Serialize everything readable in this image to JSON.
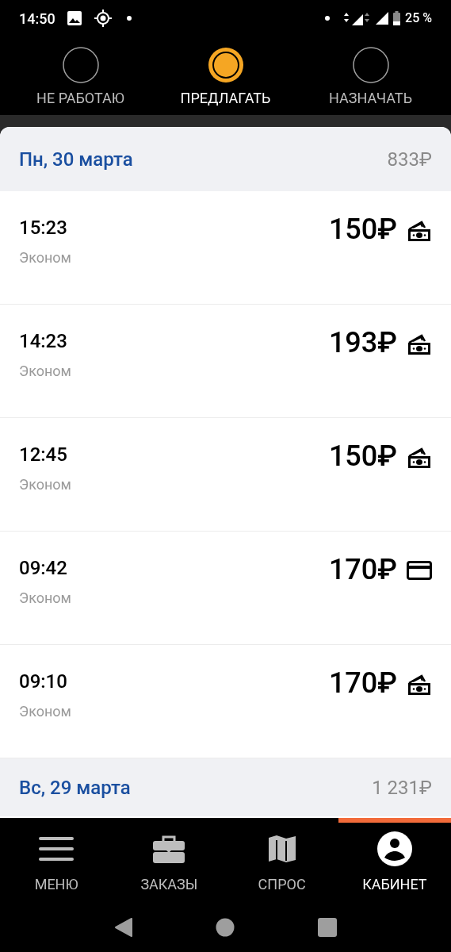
{
  "status_bar": {
    "time": "14:50",
    "battery": "25 %"
  },
  "modes": [
    {
      "label": "НЕ РАБОТАЮ",
      "selected": false
    },
    {
      "label": "ПРЕДЛАГАТЬ",
      "selected": true
    },
    {
      "label": "НАЗНАЧАТЬ",
      "selected": false
    }
  ],
  "days": [
    {
      "date": "Пн, 30 марта",
      "total": "833₽",
      "orders": [
        {
          "time": "15:23",
          "tariff": "Эконом",
          "price": "150₽",
          "kind": "cash"
        },
        {
          "time": "14:23",
          "tariff": "Эконом",
          "price": "193₽",
          "kind": "cash"
        },
        {
          "time": "12:45",
          "tariff": "Эконом",
          "price": "150₽",
          "kind": "cash"
        },
        {
          "time": "09:42",
          "tariff": "Эконом",
          "price": "170₽",
          "kind": "card"
        },
        {
          "time": "09:10",
          "tariff": "Эконом",
          "price": "170₽",
          "kind": "cash"
        }
      ]
    },
    {
      "date": "Вс, 29 марта",
      "total": "1 231₽"
    }
  ],
  "nav": [
    {
      "kind": "menu",
      "label": "МЕНЮ",
      "selected": false
    },
    {
      "kind": "orders",
      "label": "ЗАКАЗЫ",
      "selected": false
    },
    {
      "kind": "demand",
      "label": "СПРОС",
      "selected": false
    },
    {
      "kind": "cabinet",
      "label": "КАБИНЕТ",
      "selected": true
    }
  ]
}
